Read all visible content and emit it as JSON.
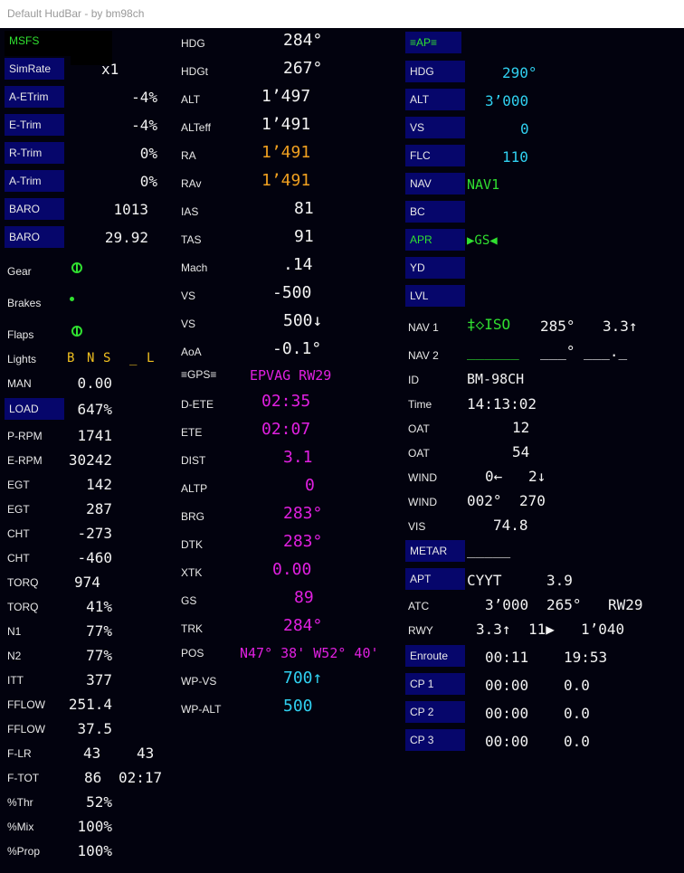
{
  "window": {
    "title": "Default HudBar - by bm98ch"
  },
  "colors": {
    "background": "#02020e",
    "button": "#06066b",
    "white": "#f2f2f2",
    "orange": "#f0a020",
    "magenta": "#e020e0",
    "cyan": "#30d0f0",
    "green": "#30e030",
    "yellow": "#f0c020"
  },
  "col1": {
    "msfs": "MSFS",
    "simrate": {
      "label": "SimRate",
      "value": "x1"
    },
    "aetrim": {
      "label": "A-ETrim",
      "value": "-4%"
    },
    "etrim": {
      "label": "E-Trim",
      "value": "-4%"
    },
    "rtrim": {
      "label": "R-Trim",
      "value": "0%"
    },
    "atrim": {
      "label": "A-Trim",
      "value": "0%"
    },
    "baro1": {
      "label": "BARO",
      "value": "1013"
    },
    "baro2": {
      "label": "BARO",
      "value": "29.92"
    },
    "gear": {
      "label": "Gear",
      "icon": "gear-down-icon"
    },
    "brakes": {
      "label": "Brakes",
      "icon": "brake-dot-icon"
    },
    "flaps": {
      "label": "Flaps",
      "icon": "flaps-icon"
    },
    "lights": {
      "label": "Lights",
      "b": "B",
      "n": "N",
      "s": "S",
      "blank": "_",
      "l": "L"
    },
    "man": {
      "label": "MAN",
      "value": "0.00"
    },
    "load": {
      "label": "LOAD",
      "value": "647%"
    },
    "prpm": {
      "label": "P-RPM",
      "value": "1741"
    },
    "erpm": {
      "label": "E-RPM",
      "value": "30242"
    },
    "egt1": {
      "label": "EGT",
      "value": "142"
    },
    "egt2": {
      "label": "EGT",
      "value": "287"
    },
    "cht1": {
      "label": "CHT",
      "value": "-273"
    },
    "cht2": {
      "label": "CHT",
      "value": "-460"
    },
    "torq1": {
      "label": "TORQ",
      "value": "974"
    },
    "torq2": {
      "label": "TORQ",
      "value": "41%"
    },
    "n1": {
      "label": "N1",
      "value": "77%"
    },
    "n2": {
      "label": "N2",
      "value": "77%"
    },
    "itt": {
      "label": "ITT",
      "value": "377"
    },
    "fflow1": {
      "label": "FFLOW",
      "value": "251.4"
    },
    "fflow2": {
      "label": "FFLOW",
      "value": "37.5"
    },
    "flr": {
      "label": "F-LR",
      "left": "43",
      "right": "43"
    },
    "ftot": {
      "label": "F-TOT",
      "value": "86",
      "time": "02:17"
    },
    "thr": {
      "label": "%Thr",
      "value": "52%"
    },
    "mix": {
      "label": "%Mix",
      "value": "100%"
    },
    "prop": {
      "label": "%Prop",
      "value": "100%"
    }
  },
  "col2": {
    "hdg": {
      "label": "HDG",
      "value": "284°"
    },
    "hdgt": {
      "label": "HDGt",
      "value": "267°"
    },
    "alt": {
      "label": "ALT",
      "value": "1’497"
    },
    "alteff": {
      "label": "ALTeff",
      "value": "1’491"
    },
    "ra": {
      "label": "RA",
      "value": "1’491"
    },
    "rav": {
      "label": "RAv",
      "value": "1’491"
    },
    "ias": {
      "label": "IAS",
      "value": "81"
    },
    "tas": {
      "label": "TAS",
      "value": "91"
    },
    "mach": {
      "label": "Mach",
      "value": ".14"
    },
    "vs1": {
      "label": "VS",
      "value": "-500"
    },
    "vs2": {
      "label": "VS",
      "value": "500↓"
    },
    "aoa": {
      "label": "AoA",
      "value": "-0.1°"
    },
    "gps": {
      "label": "≡GPS≡",
      "value": "EPVAG RW29"
    },
    "dete": {
      "label": "D-ETE",
      "value": "02:35"
    },
    "ete": {
      "label": "ETE",
      "value": "02:07"
    },
    "dist": {
      "label": "DIST",
      "value": "3.1"
    },
    "altp": {
      "label": "ALTP",
      "value": "0"
    },
    "brg": {
      "label": "BRG",
      "value": "283°"
    },
    "dtk": {
      "label": "DTK",
      "value": "283°"
    },
    "xtk": {
      "label": "XTK",
      "value": "0.00"
    },
    "gs": {
      "label": "GS",
      "value": "89"
    },
    "trk": {
      "label": "TRK",
      "value": "284°"
    },
    "pos": {
      "label": "POS",
      "value": "N47° 38' W52° 40'"
    },
    "wpvs": {
      "label": "WP-VS",
      "value": "700↑"
    },
    "wpalt": {
      "label": "WP-ALT",
      "value": "500"
    }
  },
  "col3": {
    "ap": "≡AP≡",
    "hdg": {
      "label": "HDG",
      "value": "290°"
    },
    "alt": {
      "label": "ALT",
      "value": "3’000"
    },
    "vs": {
      "label": "VS",
      "value": "0"
    },
    "flc": {
      "label": "FLC",
      "value": "110"
    },
    "nav": {
      "label": "NAV",
      "value": "NAV1"
    },
    "bc": {
      "label": "BC"
    },
    "apr": {
      "label": "APR",
      "value": "▶GS◀"
    },
    "yd": {
      "label": "YD"
    },
    "lvl": {
      "label": "LVL"
    },
    "nav1": {
      "label": "NAV 1",
      "ident": "‡◇ISO",
      "radial": "285°",
      "dist": "3.3↑"
    },
    "nav2": {
      "label": "NAV 2",
      "ident": "______",
      "radial": "___°",
      "dist": "___._"
    },
    "id": {
      "label": "ID",
      "value": "BM-98CH"
    },
    "time": {
      "label": "Time",
      "value": "14:13:02"
    },
    "oat1": {
      "label": "OAT",
      "value": "12"
    },
    "oat2": {
      "label": "OAT",
      "value": "54"
    },
    "wind1": {
      "label": "WIND",
      "a": "0←",
      "b": "2↓"
    },
    "wind2": {
      "label": "WIND",
      "a": "002°",
      "b": "270"
    },
    "vis": {
      "label": "VIS",
      "value": "74.8"
    },
    "metar": {
      "label": "METAR",
      "value": "_____"
    },
    "apt": {
      "label": "APT",
      "a": "CYYT",
      "b": "3.9"
    },
    "atc": {
      "label": "ATC",
      "a": "3’000",
      "b": "265°",
      "c": "RW29"
    },
    "rwy": {
      "label": "RWY",
      "a": "3.3↑",
      "b": "11▶",
      "c": "1’040"
    },
    "enroute": {
      "label": "Enroute",
      "a": "00:11",
      "b": "19:53"
    },
    "cp1": {
      "label": "CP 1",
      "a": "00:00",
      "b": "0.0"
    },
    "cp2": {
      "label": "CP 2",
      "a": "00:00",
      "b": "0.0"
    },
    "cp3": {
      "label": "CP 3",
      "a": "00:00",
      "b": "0.0"
    }
  }
}
